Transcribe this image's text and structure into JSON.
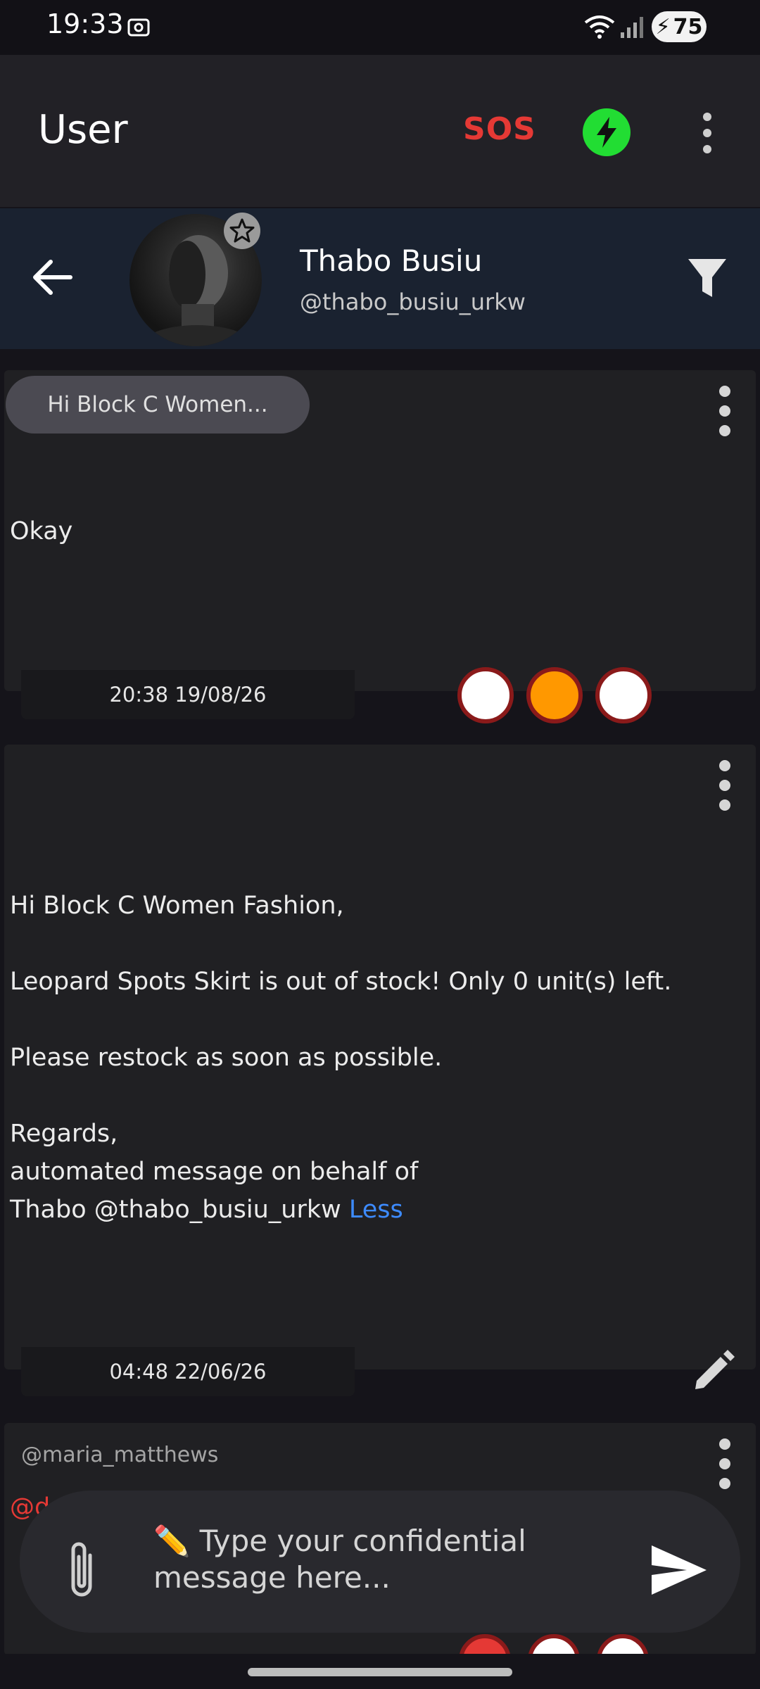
{
  "status_bar": {
    "time": "19:33",
    "battery": "75",
    "icons": [
      "screen-record-icon",
      "wifi-icon",
      "signal-icon",
      "battery-charging-icon"
    ]
  },
  "app_bar": {
    "title": "User",
    "sos_label": "SOS",
    "accent_colors": {
      "sos": "#e53935",
      "power": "#22dd33"
    }
  },
  "profile": {
    "name": "Thabo Busiu",
    "handle": "@thabo_busiu_urkw"
  },
  "messages": [
    {
      "reply_preview": "Hi Block C Women...",
      "text": "Okay",
      "time": "20:38 19/08/26",
      "status_dot_colors": [
        "#ffffff",
        "#ff9800",
        "#ffffff"
      ]
    },
    {
      "text": "Hi Block C Women Fashion,\n\n Leopard Spots Skirt is out of stock! Only 0 unit(s) left.\n\n Please restock as soon as possible.\n\nRegards,\nautomated message on behalf of\nThabo @thabo_busiu_urkw ",
      "less_label": "Less",
      "time": "04:48 22/06/26"
    },
    {
      "sender": "@maria_matthews",
      "mention_fragment": "@d"
    }
  ],
  "composer": {
    "placeholder": "✏️ Type your confidential message here..."
  }
}
